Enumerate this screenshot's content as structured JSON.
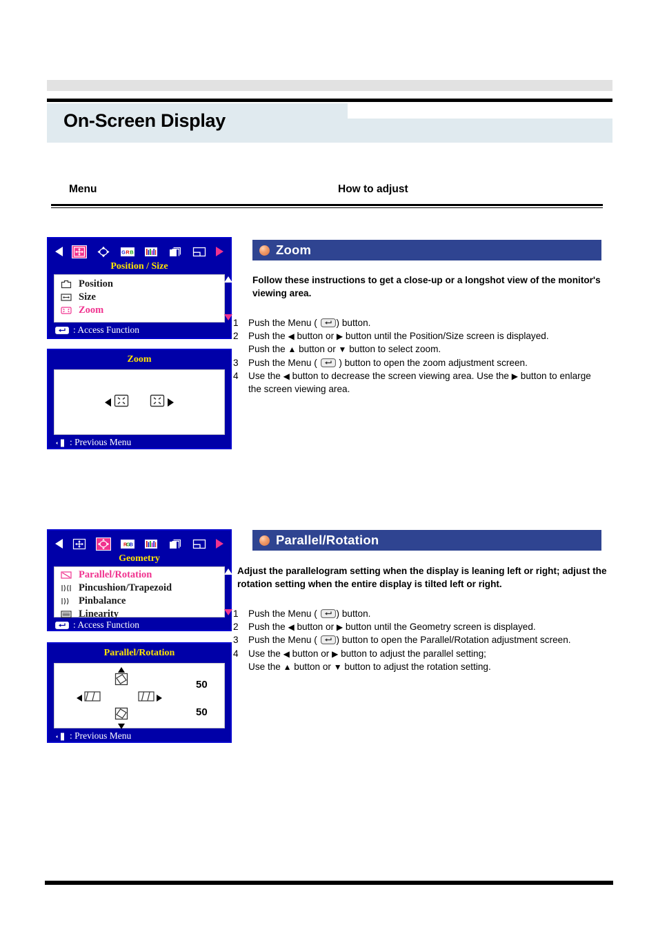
{
  "page": {
    "title": "On-Screen Display",
    "columns": {
      "menu": "Menu",
      "how_to_adjust": "How to adjust"
    }
  },
  "sections": [
    {
      "id": "zoom",
      "heading": "Zoom",
      "bullet_color": "#e8915c",
      "header_bg": "#2f4491",
      "description": "Follow these instructions to get a close-up or a longshot view of the monitor's viewing area.",
      "steps": [
        {
          "num": "1",
          "prefix": "Push the Menu (",
          "key": "menu-key-icon",
          "suffix": ") button."
        },
        {
          "num": "2",
          "text_a": "Push the ",
          "arrow_a": "◀",
          "text_b": " button or ",
          "arrow_b": "▶",
          "text_c": " button until the Position/Size screen is displayed."
        },
        {
          "num": "",
          "text_a": "Push the ",
          "arrow_a": "▲",
          "text_b": " button or ",
          "arrow_b": "▼",
          "text_c": " button to select zoom."
        },
        {
          "num": "3",
          "prefix": "Push the Menu (",
          "key": "menu-key-icon",
          "suffix": ") button to open the zoom adjustment screen."
        },
        {
          "num": "4",
          "text_a": "Use the ",
          "arrow_a": "◀",
          "text_b": " button to decrease the screen viewing area. Use the ",
          "arrow_b": "▶",
          "text_c": " button to enlarge the screen viewing area."
        }
      ],
      "osd_menu": {
        "nav_left_icon": "nav-left-arrow-icon",
        "nav_right_icon": "nav-right-arrow-icon",
        "tabs": [
          {
            "name": "position-size-tab-icon",
            "selected": true
          },
          {
            "name": "geometry-tab-icon",
            "selected": false
          },
          {
            "name": "rgb-color-tab-icon",
            "selected": false
          },
          {
            "name": "picture-tab-icon",
            "selected": false
          },
          {
            "name": "osd-tab-icon",
            "selected": false
          },
          {
            "name": "setup-tab-icon",
            "selected": false
          }
        ],
        "title": "Position / Size",
        "items": [
          {
            "label": "Position",
            "icon": "position-icon",
            "selected": false
          },
          {
            "label": "Size",
            "icon": "size-icon",
            "selected": false
          },
          {
            "label": "Zoom",
            "icon": "zoom-icon",
            "selected": true
          }
        ],
        "footer": ": Access Function",
        "footer_icon": "enter-key-icon"
      },
      "osd_adjust": {
        "title": "Zoom",
        "left_icon": "zoom-out-icon",
        "right_icon": "zoom-in-icon",
        "footer": ": Previous Menu",
        "footer_icon": "exit-door-icon",
        "values": []
      }
    },
    {
      "id": "parallel-rotation",
      "heading": "Parallel/Rotation",
      "bullet_color": "#e8915c",
      "header_bg": "#2f4491",
      "description": "Adjust the parallelogram setting when the display is leaning left or right; adjust the rotation setting when the entire display is tilted left or right.",
      "steps": [
        {
          "num": "1",
          "prefix": "Push the Menu (",
          "key": "menu-key-icon",
          "suffix": ") button."
        },
        {
          "num": "2",
          "text_a": "Push the ",
          "arrow_a": "◀",
          "text_b": " button or ",
          "arrow_b": "▶",
          "text_c": " button until the  Geometry screen is displayed."
        },
        {
          "num": "3",
          "prefix": "Push the Menu (",
          "key": "menu-key-icon",
          "suffix": ") button to open the Parallel/Rotation adjustment screen."
        },
        {
          "num": "4",
          "text_a": "Use the ",
          "arrow_a": "◀",
          "text_b": " button or ",
          "arrow_b": "▶",
          "text_c": " button to adjust the parallel setting;"
        },
        {
          "num": "",
          "text_a": "Use the ",
          "arrow_a": "▲",
          "text_b": " button or ",
          "arrow_b": "▼",
          "text_c": " button to adjust the rotation setting."
        }
      ],
      "osd_menu": {
        "nav_left_icon": "nav-left-arrow-icon",
        "nav_right_icon": "nav-right-arrow-icon",
        "tabs": [
          {
            "name": "position-size-tab-icon",
            "selected": false
          },
          {
            "name": "geometry-tab-icon",
            "selected": true
          },
          {
            "name": "rgb-color-tab-icon",
            "selected": false
          },
          {
            "name": "picture-tab-icon",
            "selected": false
          },
          {
            "name": "osd-tab-icon",
            "selected": false
          },
          {
            "name": "setup-tab-icon",
            "selected": false
          }
        ],
        "title": "Geometry",
        "items": [
          {
            "label": "Parallel/Rotation",
            "icon": "parallel-rotation-icon",
            "selected": true
          },
          {
            "label": "Pincushion/Trapezoid",
            "icon": "pincushion-icon",
            "selected": false
          },
          {
            "label": "Pinbalance",
            "icon": "pinbalance-icon",
            "selected": false
          },
          {
            "label": "Linearity",
            "icon": "linearity-icon",
            "selected": false
          }
        ],
        "footer": ": Access Function",
        "footer_icon": "enter-key-icon"
      },
      "osd_adjust": {
        "title": "Parallel/Rotation",
        "up_icon": "rotation-up-icon",
        "down_icon": "rotation-down-icon",
        "left_icon": "parallel-left-icon",
        "right_icon": "parallel-right-icon",
        "footer": ": Previous Menu",
        "footer_icon": "exit-door-icon",
        "values": [
          "50",
          "50"
        ]
      }
    }
  ],
  "colors": {
    "osd_background": "#0000a8",
    "osd_title_text": "#ffe400",
    "osd_selected_item": "#f0338f",
    "section_header_bg": "#2f4491",
    "title_band_bg": "#e0eaef",
    "topbar_bg": "#e2e2e2"
  }
}
